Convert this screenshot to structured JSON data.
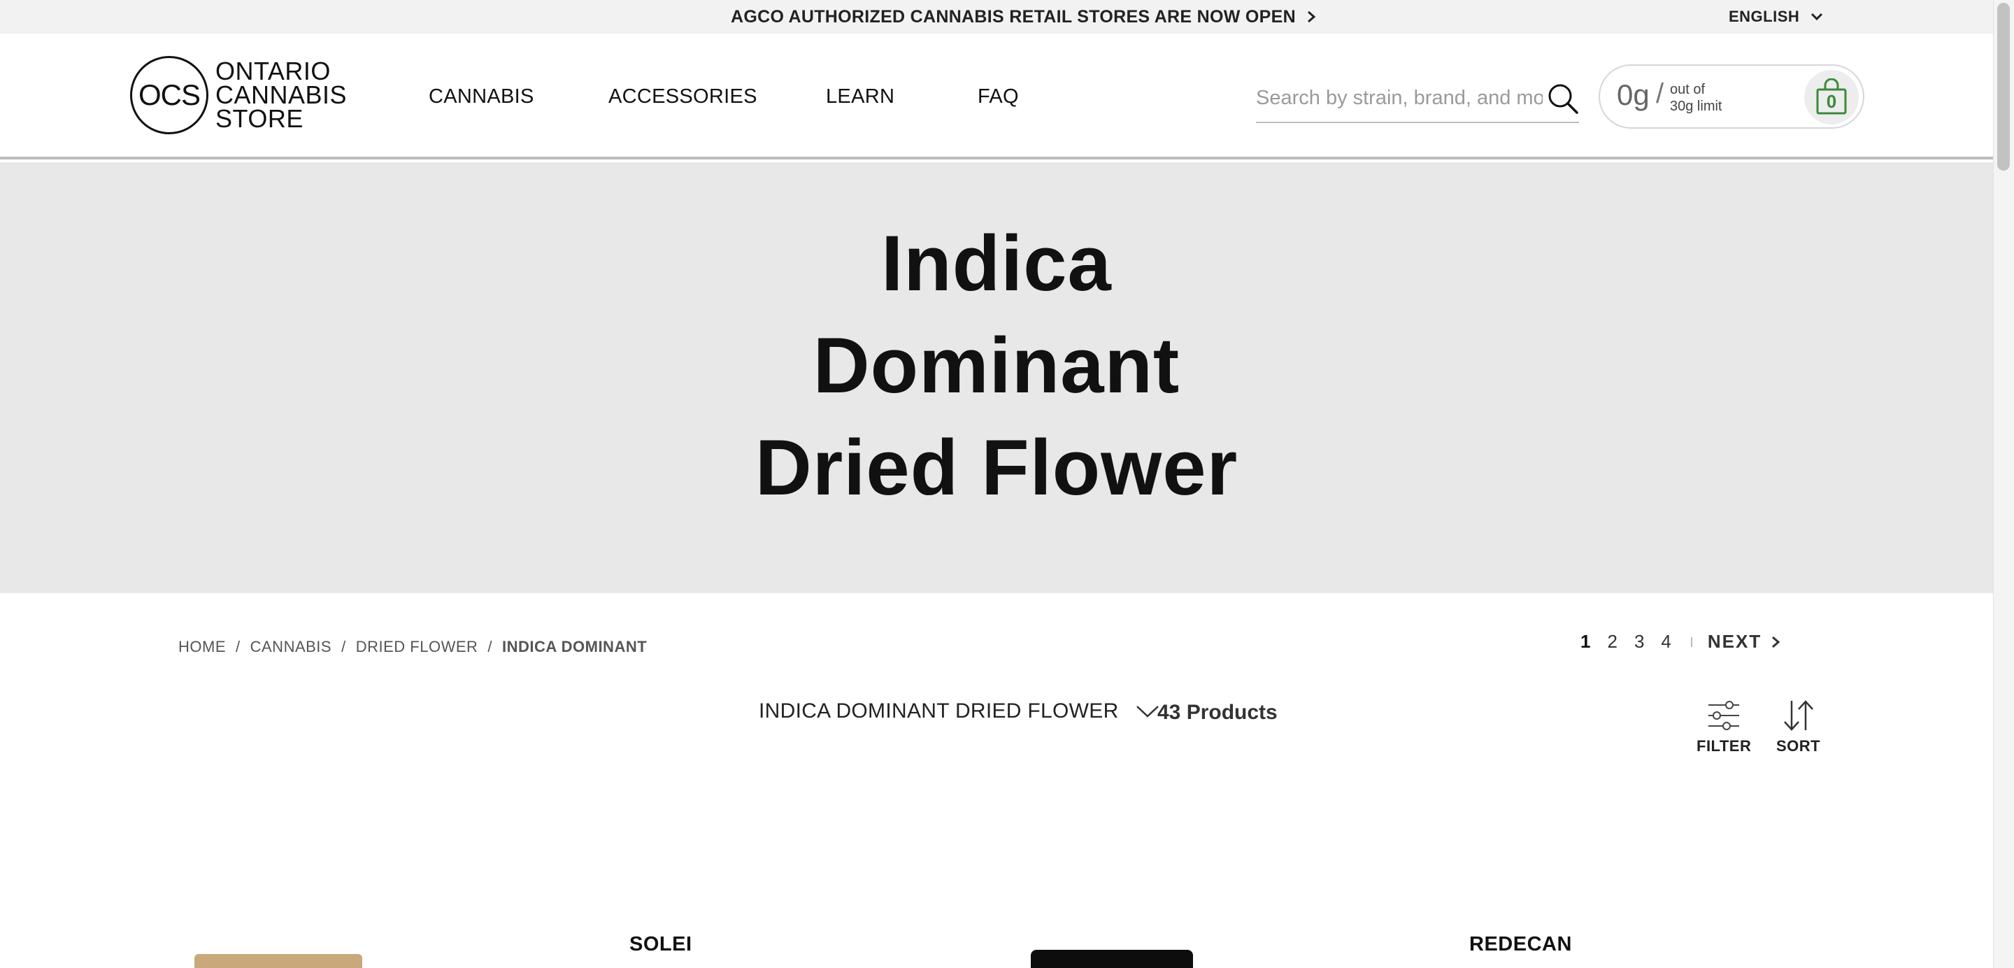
{
  "announcement": {
    "text": "AGCO AUTHORIZED CANNABIS RETAIL STORES ARE NOW OPEN"
  },
  "language": {
    "label": "ENGLISH"
  },
  "logo": {
    "mark": "OCS",
    "line1": "ONTARIO",
    "line2": "CANNABIS",
    "line3": "STORE"
  },
  "nav": {
    "cannabis": "CANNABIS",
    "accessories": "ACCESSORIES",
    "learn": "LEARN",
    "faq": "FAQ"
  },
  "search": {
    "placeholder": "Search by strain, brand, and more"
  },
  "cart": {
    "grams": "0g",
    "slash": "/",
    "limit_line1": "out of",
    "limit_line2": "30g limit",
    "count": "0"
  },
  "hero": {
    "line1": "Indica",
    "line2": "Dominant",
    "line3": "Dried Flower"
  },
  "breadcrumb": {
    "items": [
      "HOME",
      "CANNABIS",
      "DRIED FLOWER"
    ],
    "current": "INDICA DOMINANT",
    "separator": "/"
  },
  "pagination": {
    "pages": [
      "1",
      "2",
      "3",
      "4"
    ],
    "current": "1",
    "next": "NEXT"
  },
  "toolbar": {
    "category": "INDICA DOMINANT DRIED FLOWER",
    "count": "43 Products",
    "filter": "FILTER",
    "sort": "SORT"
  },
  "products": {
    "brand1": "SOLEI",
    "brand2": "REDECAN"
  },
  "colors": {
    "hero_bg": "#e8e8e8",
    "topbar_bg": "#f2f2f2",
    "cart_accent": "#3a8a3a"
  }
}
